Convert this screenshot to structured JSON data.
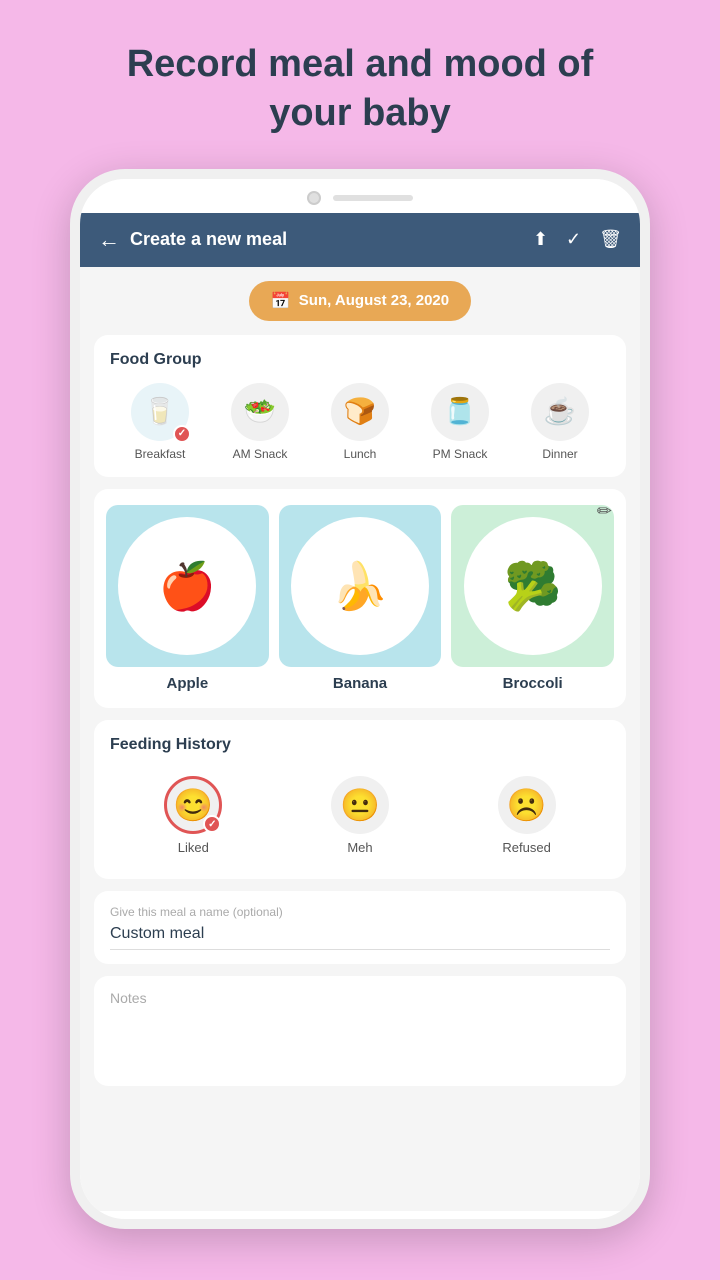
{
  "page": {
    "title_line1": "Record meal and mood of",
    "title_line2": "your baby"
  },
  "header": {
    "title": "Create a new meal",
    "back_label": "←",
    "share_icon": "⬆",
    "check_icon": "✓",
    "delete_icon": "🗑"
  },
  "date_badge": {
    "icon": "📅",
    "date": "Sun, August 23, 2020"
  },
  "food_group": {
    "section_title": "Food Group",
    "items": [
      {
        "icon": "🥛",
        "label": "Breakfast",
        "selected": true
      },
      {
        "icon": "🥗",
        "label": "AM Snack",
        "selected": false
      },
      {
        "icon": "🍞",
        "label": "Lunch",
        "selected": false
      },
      {
        "icon": "🫙",
        "label": "PM Snack",
        "selected": false
      },
      {
        "icon": "☕",
        "label": "Dinner",
        "selected": false
      }
    ]
  },
  "food_items": {
    "edit_icon": "✏",
    "items": [
      {
        "emoji": "🍎",
        "label": "Apple",
        "bg": "teal"
      },
      {
        "emoji": "🍌",
        "label": "Banana",
        "bg": "teal"
      },
      {
        "emoji": "🥦",
        "label": "Broccoli",
        "bg": "green"
      }
    ]
  },
  "feeding_history": {
    "section_title": "Feeding History",
    "moods": [
      {
        "emoji": "😊",
        "label": "Liked",
        "selected": true
      },
      {
        "emoji": "😐",
        "label": "Meh",
        "selected": false
      },
      {
        "emoji": "☹",
        "label": "Refused",
        "selected": false
      }
    ]
  },
  "meal_name": {
    "label": "Give this meal a name (optional)",
    "value": "Custom meal"
  },
  "notes": {
    "label": "Notes"
  }
}
